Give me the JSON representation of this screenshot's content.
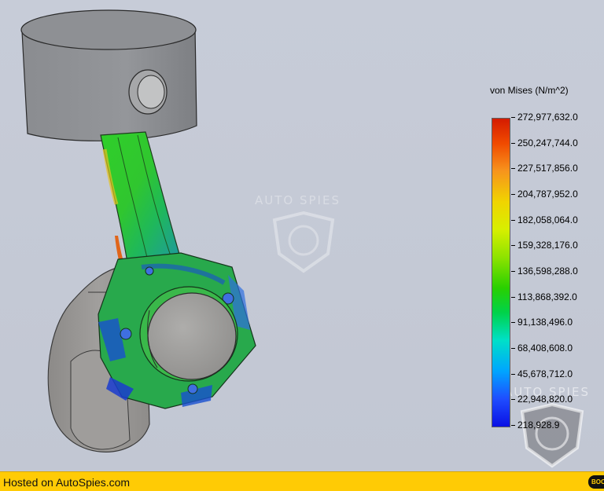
{
  "legend": {
    "title": "von Mises (N/m^2)",
    "labels": [
      "272,977,632.0",
      "250,247,744.0",
      "227,517,856.0",
      "204,787,952.0",
      "182,058,064.0",
      "159,328,176.0",
      "136,598,288.0",
      "113,868,392.0",
      "91,138,496.0",
      "68,408,608.0",
      "45,678,712.0",
      "22,948,820.0",
      "218,928.9"
    ],
    "colors": {
      "max": "#d41b00",
      "high": "#f7941d",
      "mid_high": "#f0d400",
      "mid": "#29d000",
      "mid_low": "#00e0c8",
      "low": "#00a5ff",
      "min": "#0a10e4"
    }
  },
  "watermark": {
    "text_center": "AUTO SPIES",
    "text_right": "AUTO SPIES"
  },
  "footer": {
    "text": "Hosted on AutoSpies.com",
    "badge": "BOO"
  },
  "model": {
    "piston_color": "#8d8f93",
    "crank_color": "#9a9896"
  }
}
